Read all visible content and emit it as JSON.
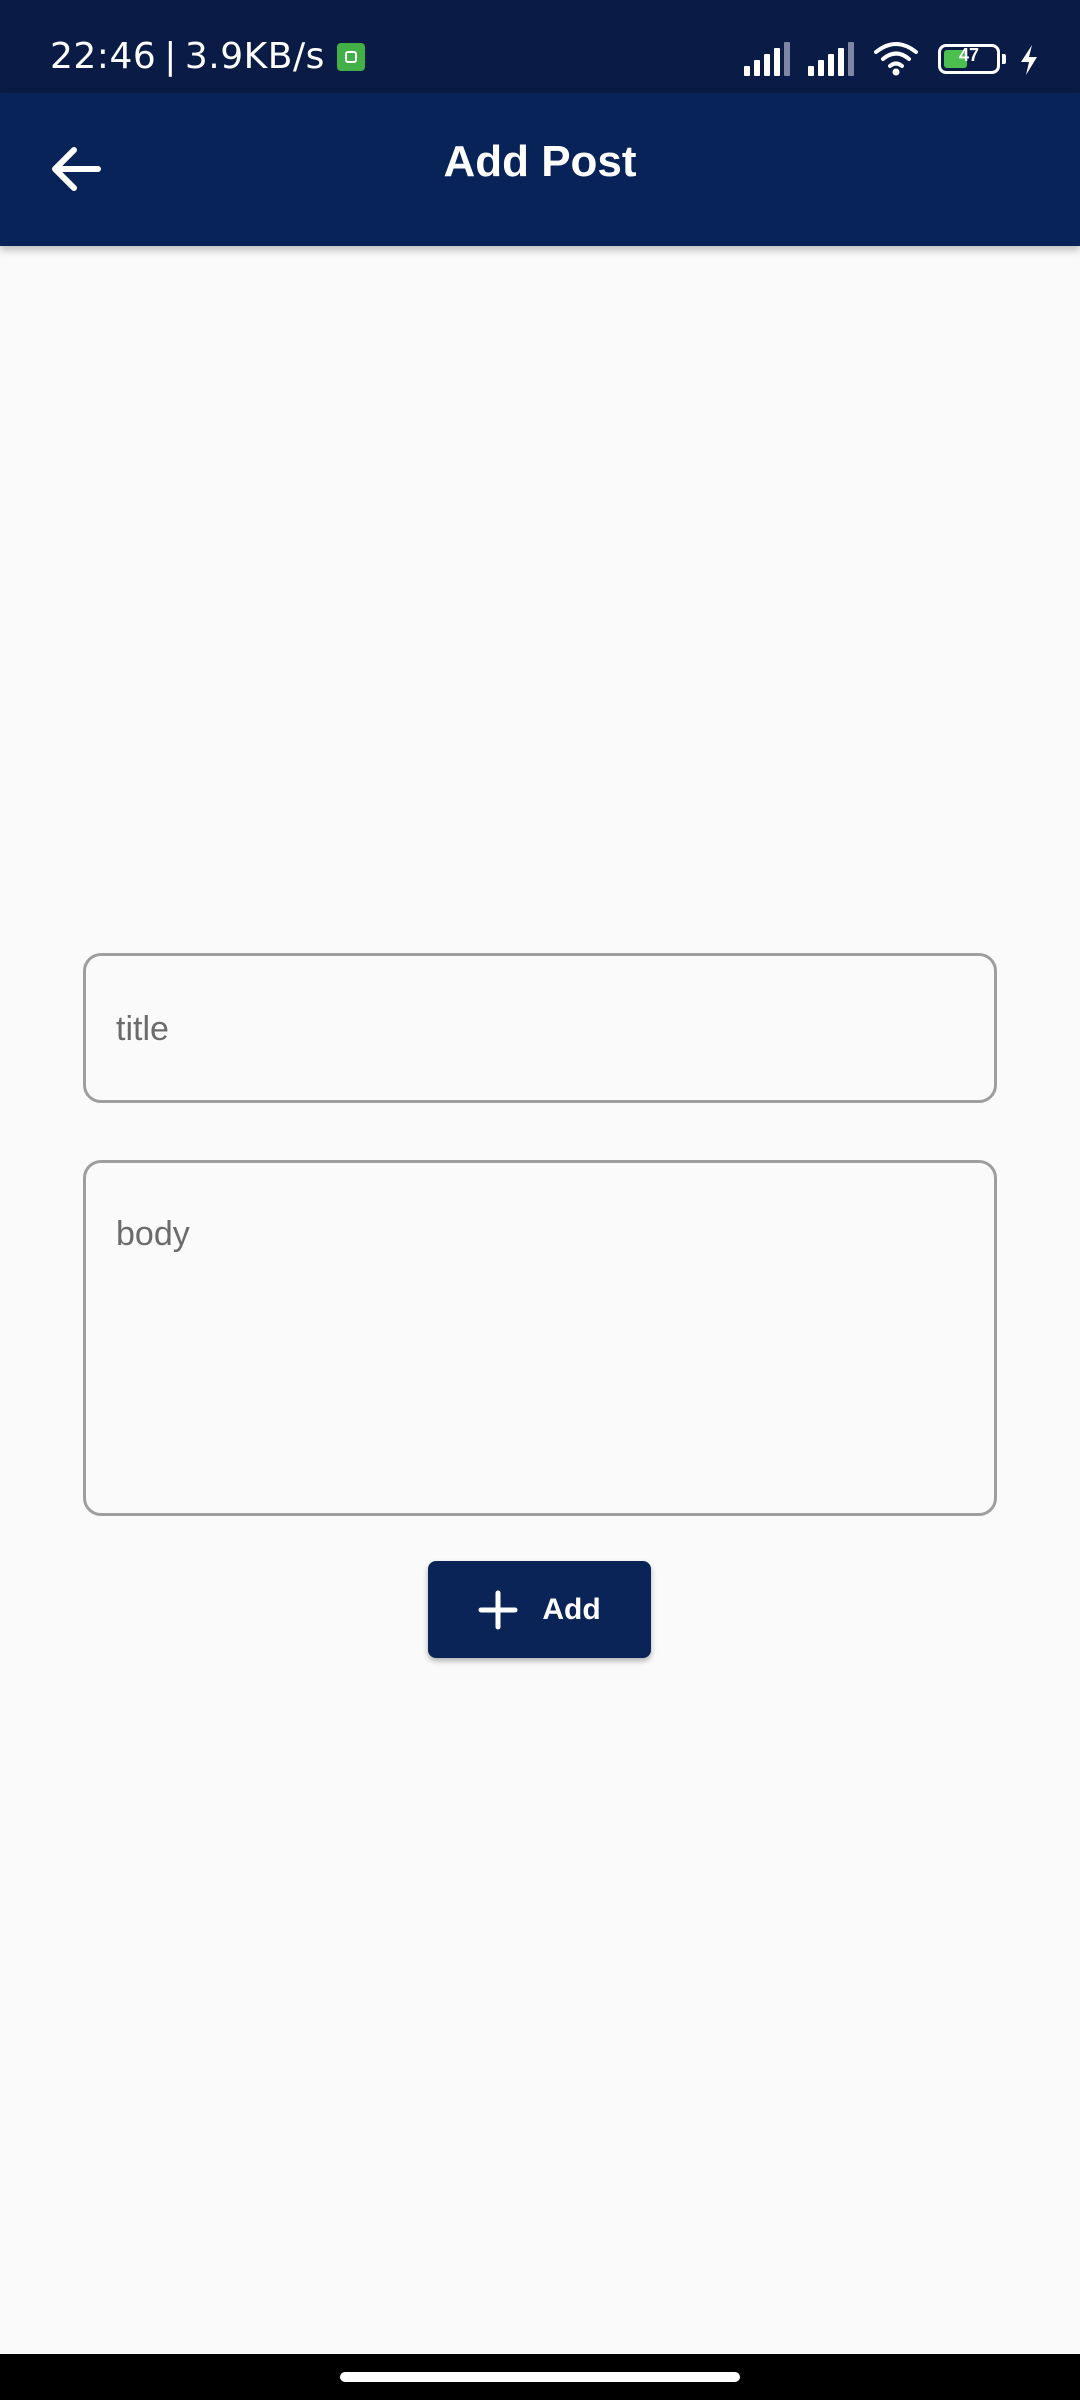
{
  "status_bar": {
    "time": "22:46",
    "network_speed": "3.9KB/s",
    "battery_level": "47",
    "battery_fraction": 0.47,
    "icons": [
      "android-notification-icon",
      "cellular-signal-icon",
      "cellular-signal-icon",
      "wifi-icon",
      "battery-icon",
      "charging-bolt-icon"
    ]
  },
  "app_bar": {
    "title": "Add Post",
    "back_icon": "arrow-left-icon"
  },
  "form": {
    "title_placeholder": "title",
    "title_value": "",
    "body_placeholder": "body",
    "body_value": "",
    "add_button_label": "Add",
    "add_button_icon": "plus-icon"
  },
  "colors": {
    "app_bar": "#082358",
    "status_bar": "#0a1c45",
    "button": "#0b2458",
    "background": "#fafafa",
    "field_border": "#9e9e9e"
  }
}
